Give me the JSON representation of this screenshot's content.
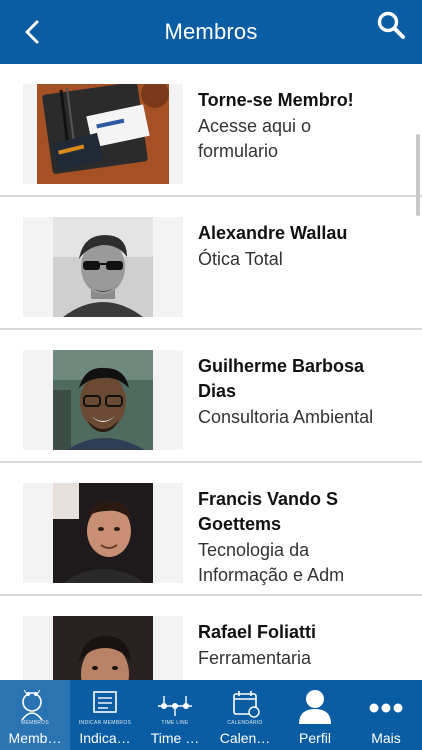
{
  "header": {
    "title": "Membros",
    "back_icon": "chevron-left-icon",
    "search_icon": "search-icon"
  },
  "members": [
    {
      "name": "Torne-se Membro!",
      "subtitle": "Acesse aqui o formulario",
      "subtitle_lines": [
        "Acesse aqui o",
        "formulario"
      ]
    },
    {
      "name": "Alexandre Wallau",
      "subtitle": "Ótica Total"
    },
    {
      "name": "Guilherme Barbosa Dias",
      "name_lines": [
        "Guilherme Barbosa",
        "Dias"
      ],
      "subtitle": "Consultoria Ambiental"
    },
    {
      "name": "Francis Vando S Goettems",
      "name_lines": [
        "Francis Vando S",
        "Goettems"
      ],
      "subtitle": "Tecnologia da Informação e Adm",
      "subtitle_lines": [
        "Tecnologia da",
        "Informação e Adm"
      ]
    },
    {
      "name": "Rafael Foliatti",
      "subtitle": "Ferramentaria"
    }
  ],
  "tabs": [
    {
      "label": "Memb…",
      "caption": "MEMBROS",
      "icon": "members-icon"
    },
    {
      "label": "Indica…",
      "caption": "INDICAR MEMBROS",
      "icon": "indicate-icon"
    },
    {
      "label": "Time …",
      "caption": "TIME LINE",
      "icon": "timeline-icon"
    },
    {
      "label": "Calen…",
      "caption": "CALENDÁRIO",
      "icon": "calendar-icon"
    },
    {
      "label": "Perfil",
      "icon": "profile-icon"
    },
    {
      "label": "Mais",
      "icon": "more-icon"
    }
  ],
  "colors": {
    "primary": "#0a5da3",
    "active_tab": "#2a74b4",
    "divider": "#d9d9d9"
  }
}
